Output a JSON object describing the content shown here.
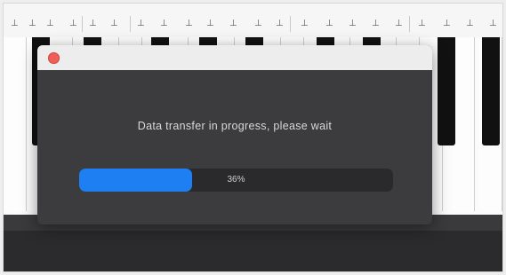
{
  "dialog": {
    "message": "Data transfer in progress, please wait",
    "progress_fraction": 0.36,
    "progress_text": "36%",
    "colors": {
      "close_button": "#ed5f57",
      "progress_fill": "#1e7ff3",
      "dialog_background": "#3c3c3e"
    }
  }
}
